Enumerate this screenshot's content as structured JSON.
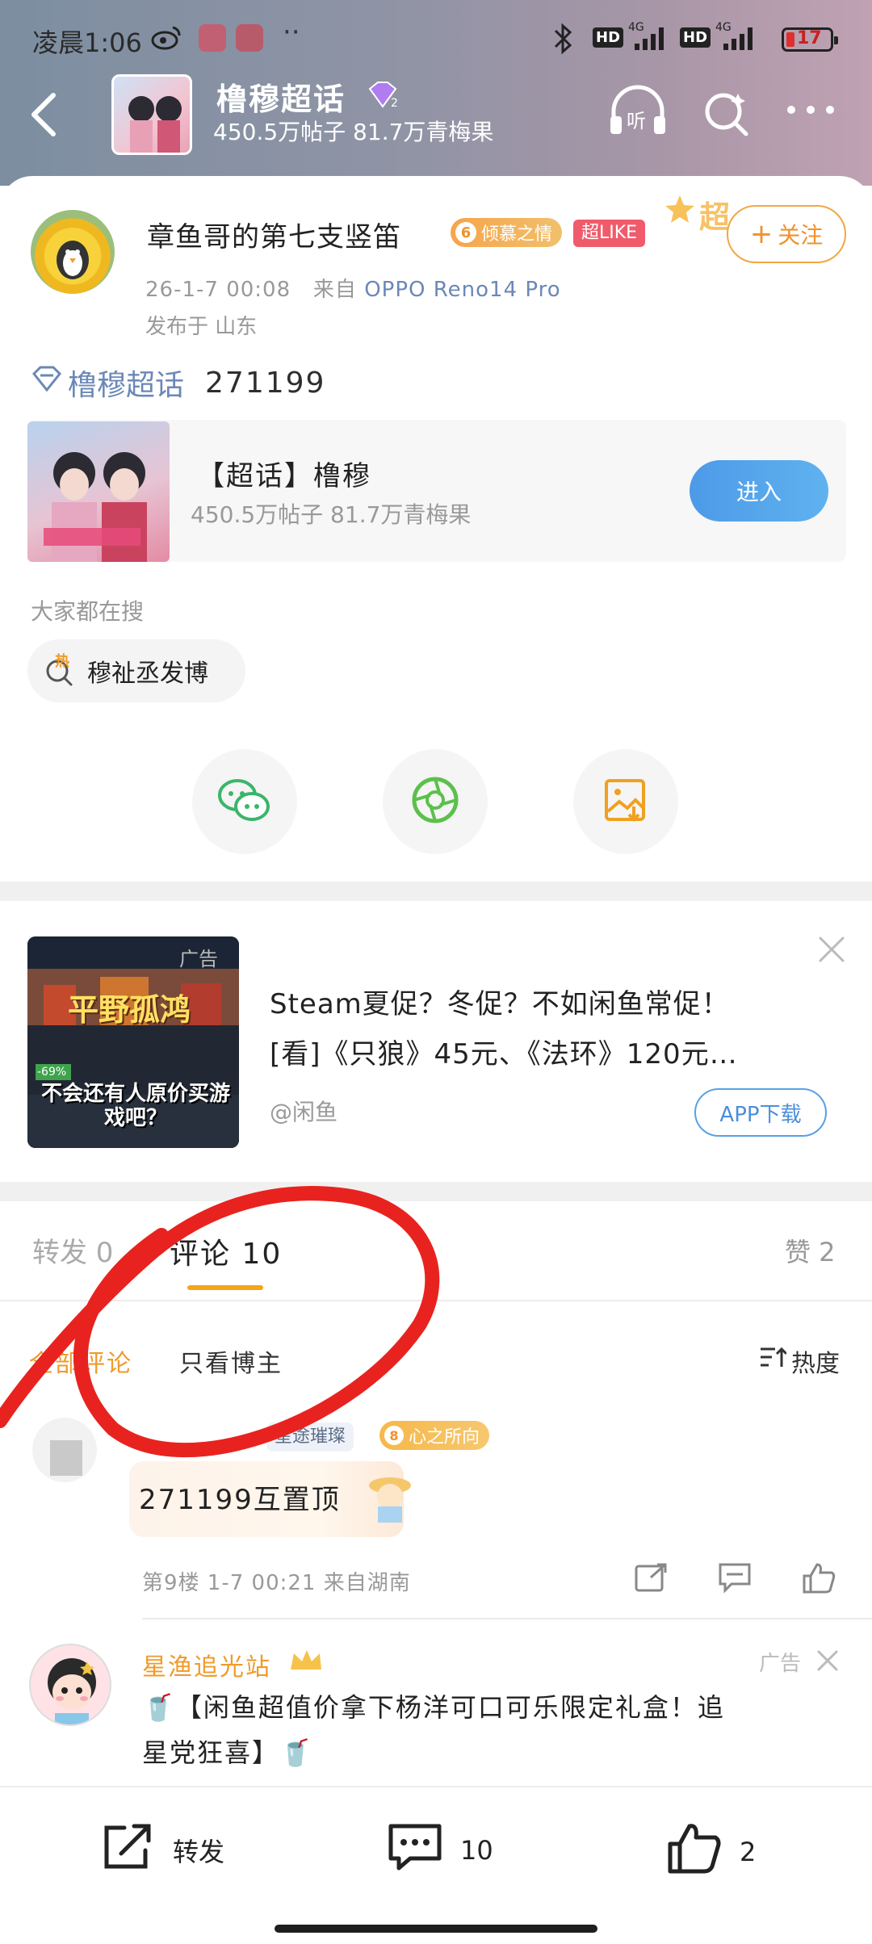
{
  "status_bar": {
    "time": "凌晨1:06",
    "signal_1": "4G",
    "signal_2": "4G",
    "hd": "HD",
    "battery": "17"
  },
  "header": {
    "title": "橹穆超话",
    "subtitle": "450.5万帖子 81.7万青梅果"
  },
  "post": {
    "username": "章鱼哥的第七支竖笛",
    "level_badge_num": "6",
    "level_badge_text": "倾慕之情",
    "super_like": "超LIKE",
    "super_tag": "超",
    "follow_label": "关注",
    "date": "26-1-7 00:08",
    "from_prefix": "来自",
    "device": "OPPO Reno14 Pro",
    "location": "发布于 山东",
    "topic_name": "橹穆超话",
    "topic_text": "271199"
  },
  "topic_card": {
    "title": "【超话】橹穆",
    "subtitle": "450.5万帖子 81.7万青梅果",
    "enter_label": "进入"
  },
  "searching": {
    "label": "大家都在搜",
    "chip_icon_text": "热",
    "chip": "穆祉丞发博"
  },
  "ad": {
    "tag": "广告",
    "line1": "Steam夏促？冬促？不如闲鱼常促！",
    "line2": "[看]《只狼》45元、《法环》120元…",
    "source": "@闲鱼",
    "download_label": "APP下载",
    "img_title": "平野孤鸿",
    "img_caption": "不会还有人原价买游戏吧？",
    "img_discount": "-69%"
  },
  "tabs": {
    "repost": "转发 0",
    "comment": "评论 10",
    "like": "赞 2"
  },
  "filters": {
    "all": "全部评论",
    "host_only": "只看博主",
    "sort": "热度"
  },
  "comment": {
    "name_chip": "星途璀璨",
    "badge_num": "8",
    "badge_text": "心之所向",
    "text": "271199互置顶",
    "meta": "第9楼 1-7 00:21 来自湖南"
  },
  "ad_comment": {
    "name": "星渔追光站",
    "tag": "广告",
    "text_line1": "🥤【闲鱼超值价拿下杨洋可口可乐限定礼盒！追",
    "text_line2": "星党狂喜】🥤"
  },
  "bottom_bar": {
    "repost": "转发",
    "comment_count": "10",
    "like_count": "2"
  },
  "colors": {
    "accent_orange": "#f09a2a",
    "link_blue": "#6b88b6",
    "enter_blue": "#4d9ae8",
    "annotation_red": "#e8231f"
  }
}
